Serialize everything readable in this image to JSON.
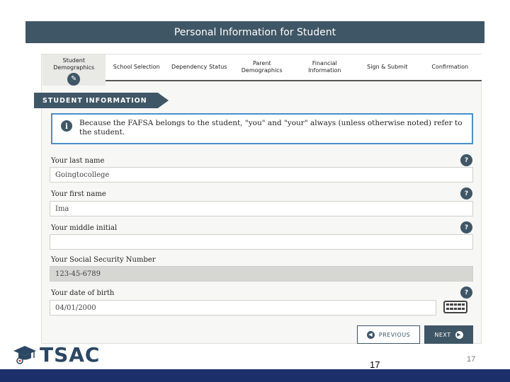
{
  "header": {
    "title": "Personal Information for Student"
  },
  "tabs": [
    {
      "label": "Student Demographics",
      "active": true
    },
    {
      "label": "School Selection",
      "active": false
    },
    {
      "label": "Dependency Status",
      "active": false
    },
    {
      "label": "Parent Demographics",
      "active": false
    },
    {
      "label": "Financial Information",
      "active": false
    },
    {
      "label": "Sign & Submit",
      "active": false
    },
    {
      "label": "Confirmation",
      "active": false
    }
  ],
  "section": {
    "title": "STUDENT INFORMATION"
  },
  "info": {
    "text": "Because the FAFSA belongs to the student, \"you\" and \"your\" always (unless otherwise noted) refer to the student."
  },
  "fields": {
    "last_name": {
      "label": "Your last name",
      "value": "Goingtocollege"
    },
    "first_name": {
      "label": "Your first name",
      "value": "Ima"
    },
    "middle_initial": {
      "label": "Your middle initial",
      "value": ""
    },
    "ssn": {
      "label": "Your Social Security Number",
      "value": "123-45-6789"
    },
    "dob": {
      "label": "Your date of birth",
      "value": "04/01/2000"
    }
  },
  "help_glyph": "?",
  "nav": {
    "previous": "PREVIOUS",
    "next": "NEXT"
  },
  "footer": {
    "logo_text": "TSAC",
    "slide_number_center": "17",
    "slide_number_right": "17"
  },
  "colors": {
    "primary": "#3f5666",
    "info_border": "#4a90c8",
    "footer_bar": "#1b2f6b"
  }
}
